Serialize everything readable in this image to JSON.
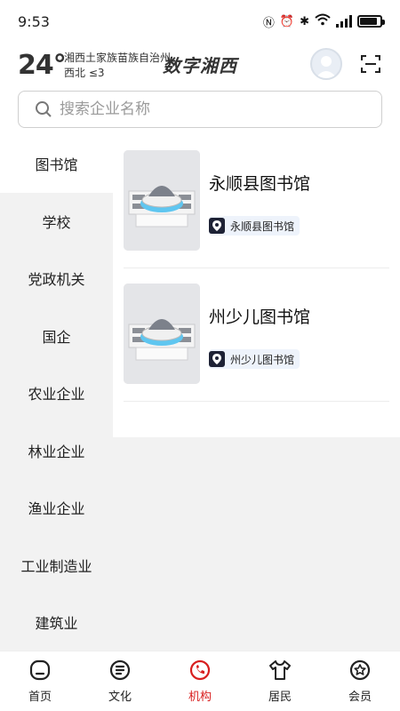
{
  "status_bar": {
    "time": "9:53",
    "battery_level": 0.85
  },
  "header": {
    "temperature": "24°",
    "location_line1": "湘西土家族苗族自治州",
    "location_line2": "西北  ≤3",
    "brand": "数字湘西",
    "search_placeholder": "搜索企业名称"
  },
  "sidebar": {
    "items": [
      {
        "label": "图书馆"
      },
      {
        "label": "学校"
      },
      {
        "label": "党政机关"
      },
      {
        "label": "国企"
      },
      {
        "label": "农业企业"
      },
      {
        "label": "林业企业"
      },
      {
        "label": "渔业企业"
      },
      {
        "label": "工业制造业"
      },
      {
        "label": "建筑业"
      }
    ],
    "active": "图书馆"
  },
  "content": {
    "cards": [
      {
        "title": "永顺县图书馆",
        "tag": "永顺县图书馆"
      },
      {
        "title": "州少儿图书馆",
        "tag": "州少儿图书馆"
      }
    ]
  },
  "tabbar": {
    "tabs": [
      {
        "label": "首页",
        "icon": "home-icon"
      },
      {
        "label": "文化",
        "icon": "document-icon"
      },
      {
        "label": "机构",
        "icon": "phone-icon"
      },
      {
        "label": "居民",
        "icon": "shirt-icon"
      },
      {
        "label": "会员",
        "icon": "star-badge-icon"
      }
    ],
    "active": "机构",
    "accent_color": "#d81e1e"
  }
}
